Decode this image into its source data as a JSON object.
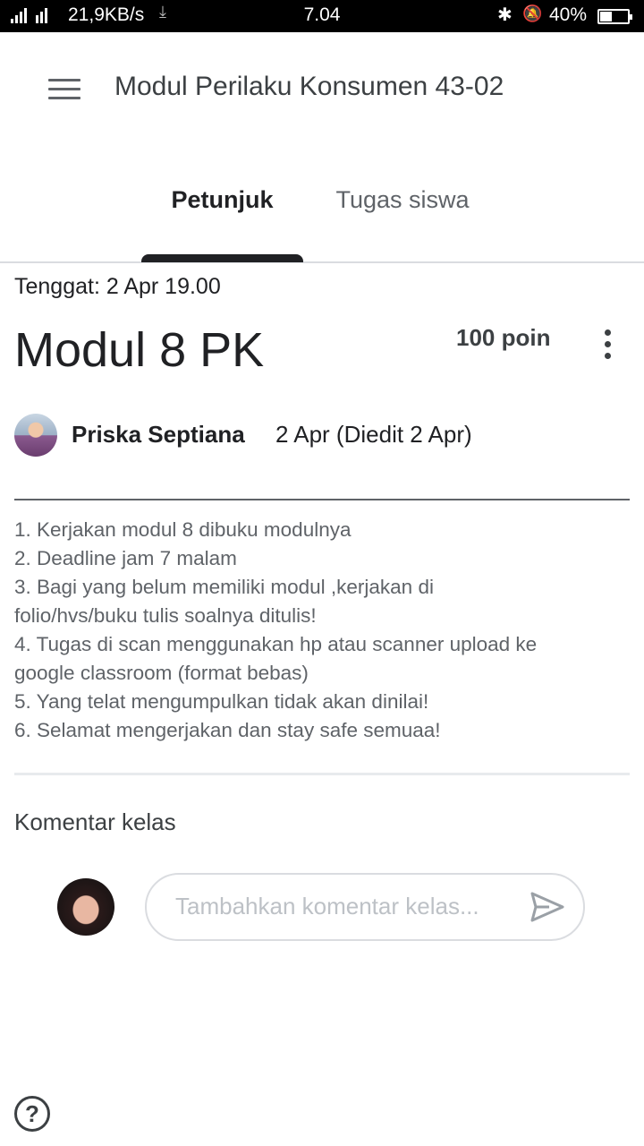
{
  "status_bar": {
    "network_speed": "21,9KB/s",
    "time": "7.04",
    "battery": "40%"
  },
  "app_bar": {
    "title": "Modul Perilaku Konsumen 43-02"
  },
  "tabs": [
    {
      "label": "Petunjuk",
      "selected": true
    },
    {
      "label": "Tugas siswa",
      "selected": false
    }
  ],
  "assignment": {
    "due": "Tenggat: 2 Apr 19.00",
    "title": "Modul 8 PK",
    "points": "100 poin",
    "author": "Priska Septiana",
    "date": "2 Apr (Diedit 2 Apr)",
    "instructions": [
      "1. Kerjakan modul 8 dibuku modulnya",
      "2. Deadline jam 7 malam",
      "3. Bagi yang belum memiliki modul ,kerjakan di",
      "folio/hvs/buku tulis soalnya ditulis!",
      "4. Tugas di scan menggunakan hp atau scanner upload ke",
      "google classroom (format bebas)",
      "5. Yang telat mengumpulkan tidak akan dinilai!",
      "6. Selamat mengerjakan dan stay safe semuaa!"
    ]
  },
  "comments": {
    "heading": "Komentar kelas",
    "placeholder": "Tambahkan komentar kelas..."
  },
  "icons": {
    "menu": "menu-icon",
    "more": "more-vert-icon",
    "send": "send-icon",
    "help": "help-icon"
  },
  "colors": {
    "primary_text": "#202124",
    "secondary_text": "#5f6368",
    "divider": "#dadce0"
  }
}
